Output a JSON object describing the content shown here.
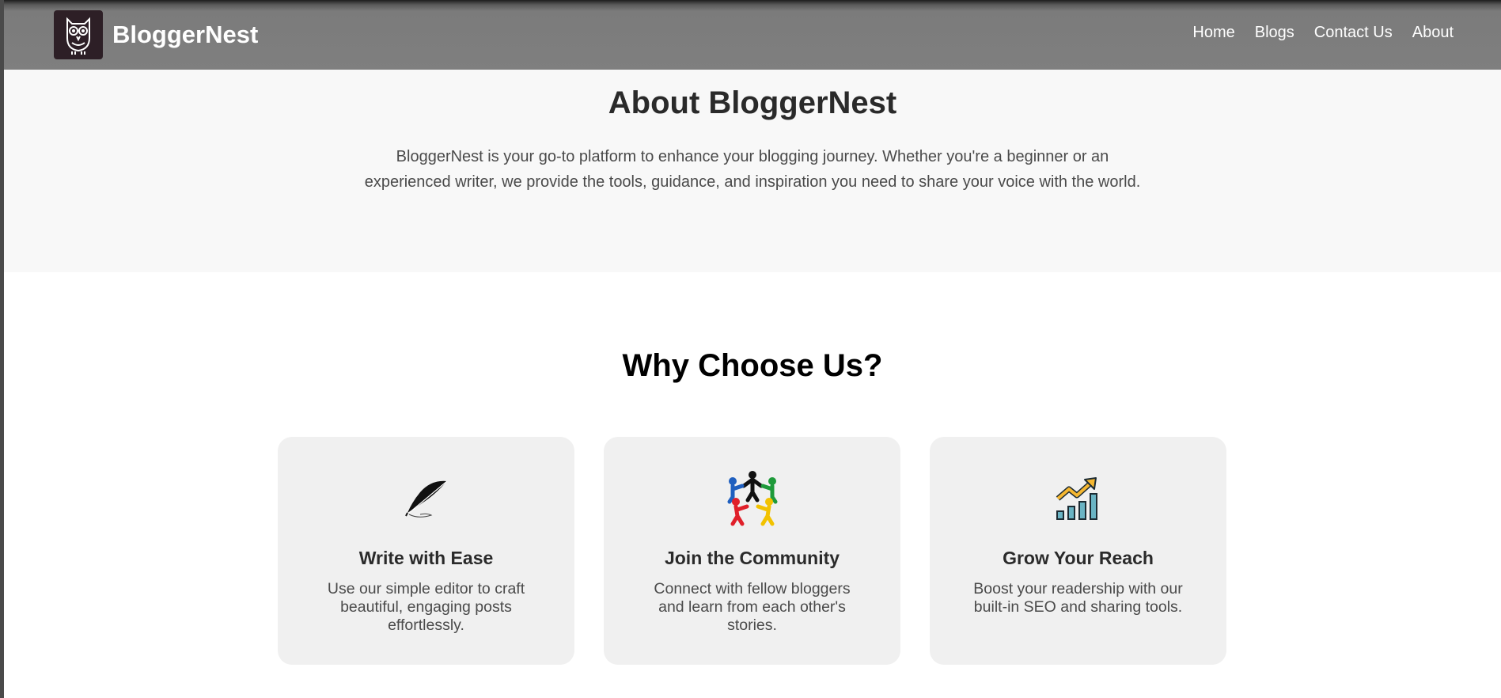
{
  "nav": {
    "brand": "BloggerNest",
    "links": [
      "Home",
      "Blogs",
      "Contact Us",
      "About"
    ]
  },
  "about": {
    "title": "About BloggerNest",
    "text": "BloggerNest is your go-to platform to enhance your blogging journey. Whether you're a beginner or an experienced writer, we provide the tools, guidance, and inspiration you need to share your voice with the world."
  },
  "why": {
    "title": "Why Choose Us?",
    "cards": [
      {
        "icon": "quill-icon",
        "title": "Write with Ease",
        "text": "Use our simple editor to craft beautiful, engaging posts effortlessly."
      },
      {
        "icon": "community-icon",
        "title": "Join the Community",
        "text": "Connect with fellow bloggers and learn from each other's stories."
      },
      {
        "icon": "growth-chart-icon",
        "title": "Grow Your Reach",
        "text": "Boost your readership with our built-in SEO and sharing tools."
      }
    ]
  },
  "colors": {
    "navbar": "#7f7f7f",
    "logo_bg": "#2d1f26",
    "about_bg": "#f8f8f8",
    "card_bg": "#f0f0f0"
  }
}
